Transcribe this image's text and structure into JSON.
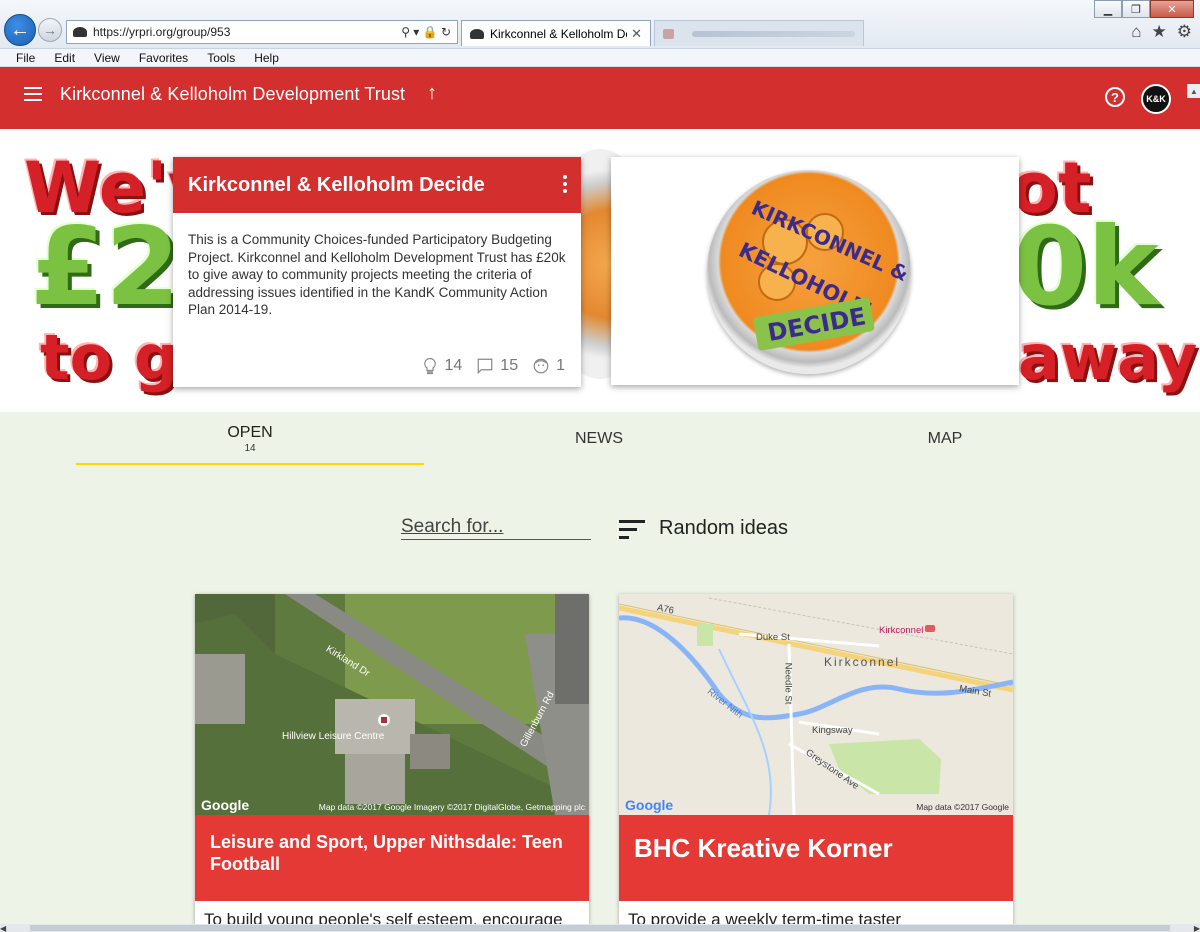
{
  "browser": {
    "url": "https://yrpri.org/group/953",
    "active_tab_title": "Kirkconnel & Kelloholm De...",
    "back_glyph": "←",
    "forward_glyph": "→",
    "tab_close_glyph": "✕",
    "address_tools": "⚲ ▾ 🔒 ↻"
  },
  "window_controls": {
    "minimize": "▁",
    "restore": "❐",
    "close": "✕"
  },
  "toolbar_icons": {
    "home": "⌂",
    "favorites": "★",
    "settings": "⚙"
  },
  "menu": [
    "File",
    "Edit",
    "View",
    "Favorites",
    "Tools",
    "Help"
  ],
  "header": {
    "title": "Kirkconnel & Kelloholm Development Trust",
    "up_glyph": "↑",
    "help_glyph": "?",
    "avatar_text": "K&K",
    "color": "#d32f2f"
  },
  "banner": {
    "line1": "We'v",
    "line1_right": "ot",
    "amount_left": "£2",
    "amount_right": "0k",
    "line3_left": "to gi",
    "line3_right": "away"
  },
  "group": {
    "title": "Kirkconnel & Kelloholm Decide",
    "description": "This is a Community Choices-funded Participatory Budgeting Project. Kirkconnel and Kelloholm Development Trust has £20k to give away to community projects meeting the criteria of addressing issues identified in the KandK Community Action Plan 2014-19.",
    "ideas_count": "14",
    "comments_count": "15",
    "members_count": "1"
  },
  "logo": {
    "ring_text": "KIRKCONNEL &",
    "lower_text": "KELLOHOLM",
    "badge": "DECIDE"
  },
  "tabs": {
    "open_label": "OPEN",
    "open_count": "14",
    "news_label": "NEWS",
    "map_label": "MAP",
    "indicator_color": "#ffd600"
  },
  "search": {
    "placeholder": "Search for..."
  },
  "sort": {
    "label": "Random ideas"
  },
  "ideas": [
    {
      "title": "Leisure and Sport, Upper Nithsdale: Teen Football",
      "description": "To build young people's self esteem, encourage",
      "map": {
        "google": "Google",
        "attribution": "Map data ©2017 Google Imagery ©2017 DigitalGlobe, Getmapping plc",
        "labels": [
          "Kirkland Dr",
          "Hillview Leisure Centre",
          "Gillenburn Rd"
        ]
      }
    },
    {
      "title": "BHC Kreative Korner",
      "description": "To provide a weekly term-time taster",
      "map": {
        "google": "Google",
        "attribution": "Map data ©2017 Google",
        "labels": [
          "A76",
          "Duke St",
          "Kirkconnel",
          "Kirkconnel",
          "Main St",
          "River Nith",
          "Needle St",
          "Kingsway",
          "Greystone Ave"
        ]
      }
    }
  ],
  "scrollbar": {
    "left_glyph": "◀",
    "right_glyph": "▶",
    "up_glyph": "▲"
  }
}
